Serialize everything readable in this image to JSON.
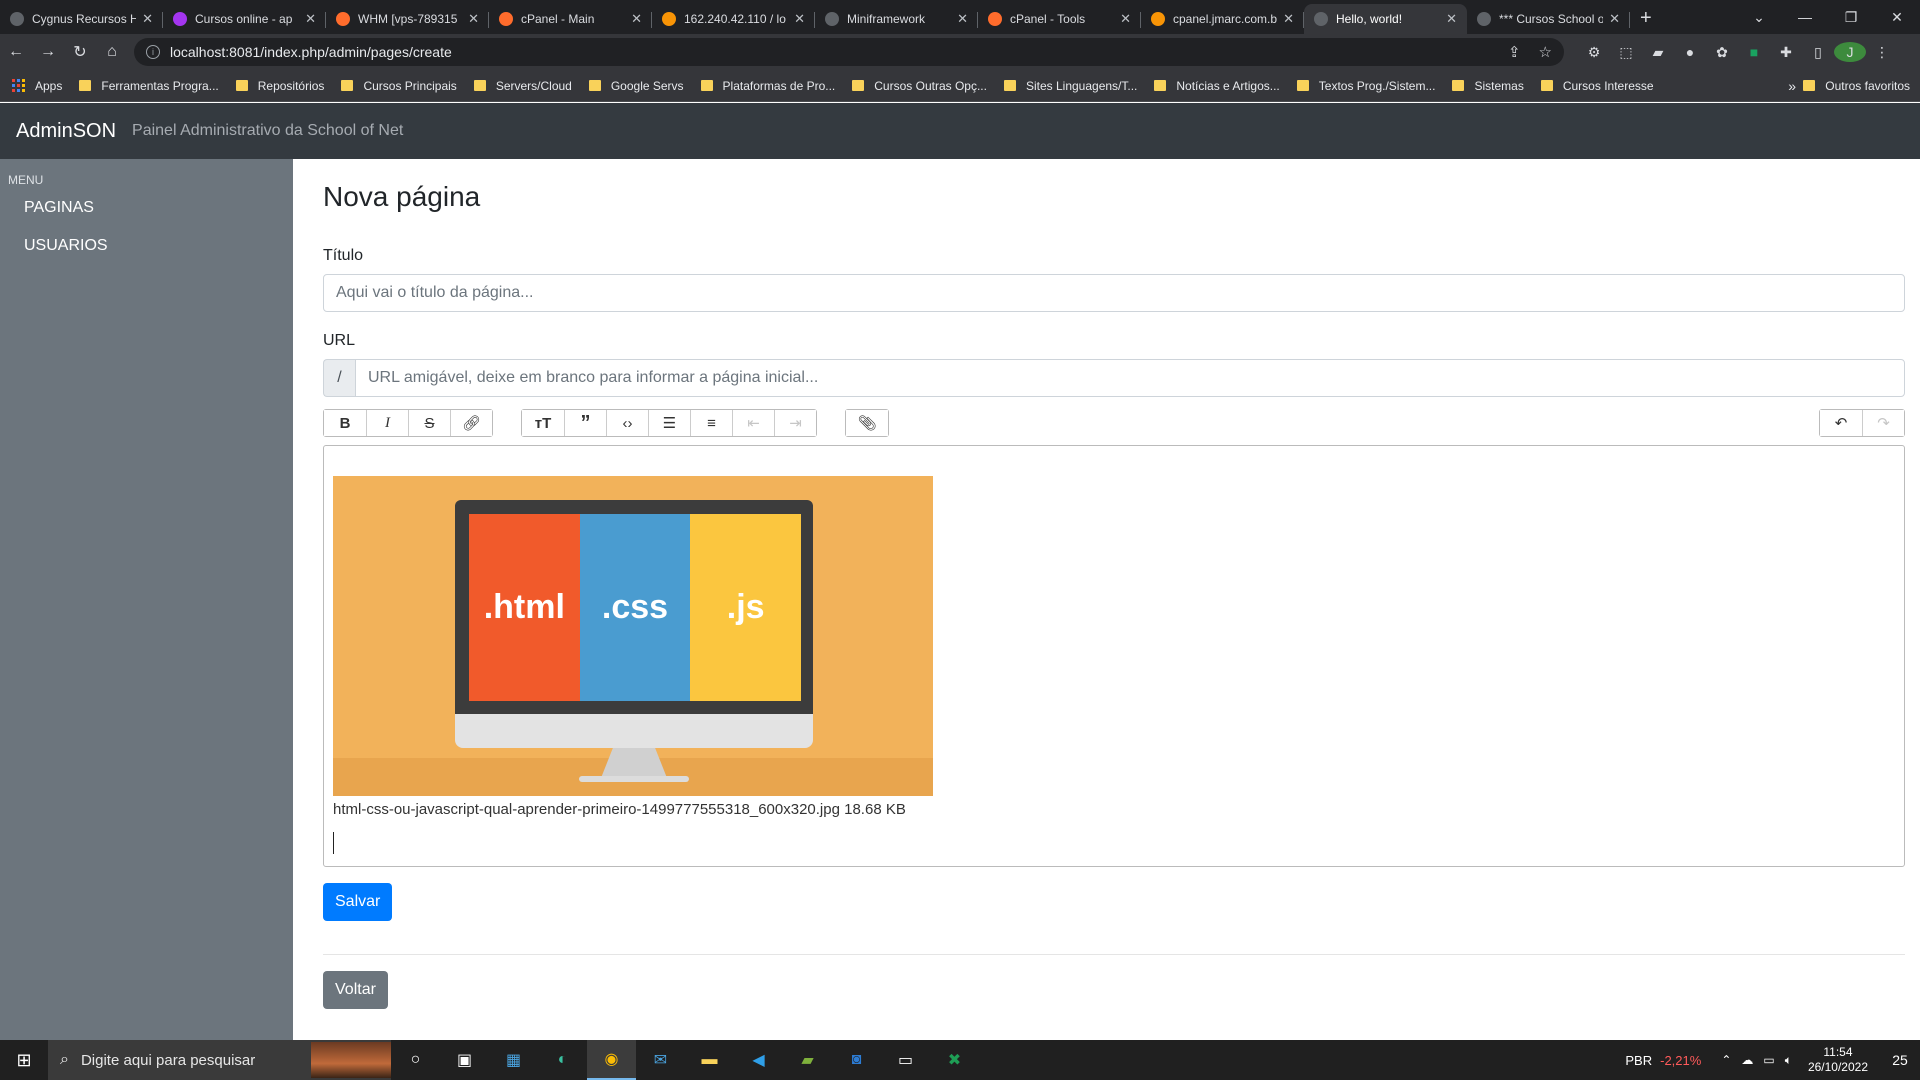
{
  "browser": {
    "tabs": [
      {
        "title": "Cygnus Recursos H",
        "icon": "globe-icon",
        "color": "#5f6368"
      },
      {
        "title": "Cursos online - ap",
        "icon": "udemy-icon",
        "color": "#a435f0"
      },
      {
        "title": "WHM [vps-789315",
        "icon": "cpanel-icon",
        "color": "#ff6c2c"
      },
      {
        "title": "cPanel - Main",
        "icon": "cpanel-icon",
        "color": "#ff6c2c"
      },
      {
        "title": "162.240.42.110 / lo",
        "icon": "phpmyadmin-icon",
        "color": "#f89406"
      },
      {
        "title": "Miniframework",
        "icon": "globe-icon",
        "color": "#5f6368"
      },
      {
        "title": "cPanel - Tools",
        "icon": "cpanel-icon",
        "color": "#ff6c2c"
      },
      {
        "title": "cpanel.jmarc.com.b",
        "icon": "phpmyadmin-icon",
        "color": "#f89406"
      },
      {
        "title": "Hello, world!",
        "icon": "globe-icon",
        "color": "#5f6368",
        "active": true
      },
      {
        "title": "*** Cursos School o",
        "icon": "globe-icon",
        "color": "#5f6368"
      }
    ],
    "address": "localhost:8081/index.php/admin/pages/create",
    "bookmarks": [
      "Ferramentas Progra...",
      "Repositórios",
      "Cursos Principais",
      "Servers/Cloud",
      "Google Servs",
      "Plataformas de Pro...",
      "Cursos Outras Opç...",
      "Sites Linguagens/T...",
      "Notícias e Artigos...",
      "Textos Prog./Sistem...",
      "Sistemas",
      "Cursos Interesse"
    ],
    "apps_label": "Apps",
    "more_label": "»",
    "other_favorites": "Outros favoritos",
    "avatar_letter": "J"
  },
  "app": {
    "brand": "AdminSON",
    "subtitle": "Painel Administrativo da School of Net"
  },
  "sidebar": {
    "menu_label": "MENU",
    "items": [
      {
        "label": "PAGINAS"
      },
      {
        "label": "USUARIOS"
      }
    ]
  },
  "page": {
    "title": "Nova página",
    "title_label": "Título",
    "title_placeholder": "Aqui vai o título da página...",
    "url_label": "URL",
    "url_prefix": "/",
    "url_placeholder": "URL amigável, deixe em branco para informar a página inicial...",
    "attachment": {
      "caption": "html-css-ou-javascript-qual-aprender-primeiro-1499777555318_600x320.jpg 18.68 KB",
      "panels": [
        {
          "text": ".html",
          "color": "#f15a2b"
        },
        {
          "text": ".css",
          "color": "#4a9cd0"
        },
        {
          "text": ".js",
          "color": "#fbc63f"
        }
      ]
    },
    "save_label": "Salvar",
    "back_label": "Voltar"
  },
  "taskbar": {
    "search_placeholder": "Digite aqui para pesquisar",
    "ticker": "PBR",
    "ticker_change": "-2,21%",
    "time": "11:54",
    "date": "26/10/2022",
    "notifications": "25"
  }
}
